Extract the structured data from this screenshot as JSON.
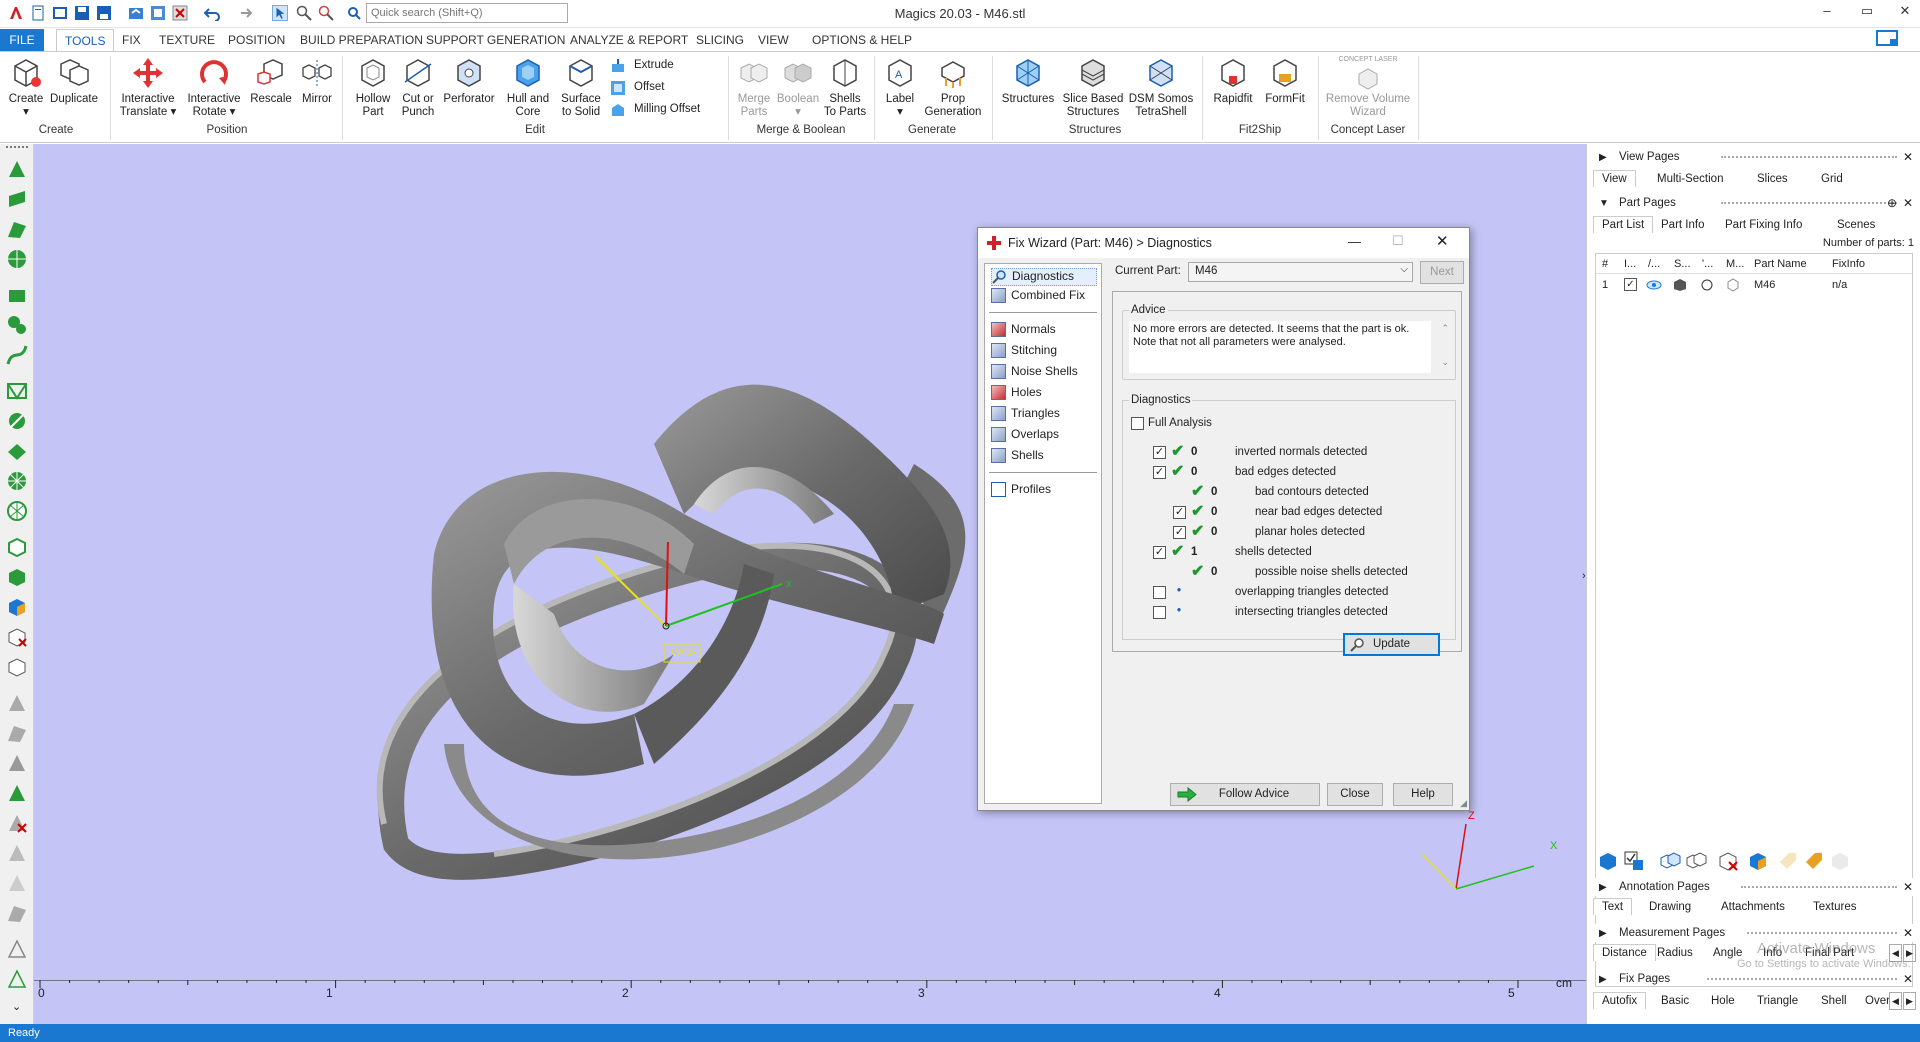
{
  "window": {
    "title": "Magics 20.03 - M46.stl",
    "minimize": "–",
    "maximize": "▭",
    "close": "✕"
  },
  "search": {
    "placeholder": "Quick search (Shift+Q)"
  },
  "menu_tabs": [
    "FILE",
    "TOOLS",
    "FIX",
    "TEXTURE",
    "POSITION",
    "BUILD PREPARATION",
    "SUPPORT GENERATION",
    "ANALYZE & REPORT",
    "SLICING",
    "VIEW",
    "OPTIONS & HELP"
  ],
  "ribbon": {
    "buttons": [
      {
        "l1": "Create",
        "l2": "▾"
      },
      {
        "l1": "Duplicate",
        "l2": ""
      },
      {
        "l1": "Interactive",
        "l2": "Translate ▾"
      },
      {
        "l1": "Interactive",
        "l2": "Rotate ▾"
      },
      {
        "l1": "Rescale",
        "l2": ""
      },
      {
        "l1": "Mirror",
        "l2": ""
      },
      {
        "l1": "Hollow",
        "l2": "Part"
      },
      {
        "l1": "Cut or",
        "l2": "Punch"
      },
      {
        "l1": "Perforator",
        "l2": ""
      },
      {
        "l1": "Hull and",
        "l2": "Core"
      },
      {
        "l1": "Surface",
        "l2": "to Solid"
      },
      {
        "l1": "Merge",
        "l2": "Parts"
      },
      {
        "l1": "Boolean",
        "l2": "▾"
      },
      {
        "l1": "Shells",
        "l2": "To Parts"
      },
      {
        "l1": "Label",
        "l2": "▾"
      },
      {
        "l1": "Prop",
        "l2": "Generation"
      },
      {
        "l1": "Structures",
        "l2": ""
      },
      {
        "l1": "Slice Based",
        "l2": "Structures"
      },
      {
        "l1": "DSM Somos",
        "l2": "TetraShell"
      },
      {
        "l1": "Rapidfit",
        "l2": ""
      },
      {
        "l1": "FormFit",
        "l2": ""
      },
      {
        "l1": "Remove Volume",
        "l2": "Wizard"
      }
    ],
    "small_buttons": [
      "Extrude",
      "Offset",
      "Milling Offset"
    ],
    "concept_laser_logo": "CONCEPT LASER",
    "groups": [
      "Create",
      "Position",
      "Edit",
      "Merge & Boolean",
      "Generate",
      "Structures",
      "Fit2Ship",
      "Concept Laser"
    ]
  },
  "viewport": {
    "wcs_label": "WCS",
    "ruler_ticks": [
      "0",
      "1",
      "2",
      "3",
      "4",
      "5"
    ],
    "ruler_unit": "cm",
    "axes": {
      "x": "x",
      "z": "z",
      "bx": "X",
      "bz": "Z"
    }
  },
  "status": "Ready",
  "right_panel": {
    "view_pages": {
      "title": "View Pages",
      "tabs": [
        "View",
        "Multi-Section",
        "Slices",
        "Grid"
      ]
    },
    "part_pages": {
      "title": "Part Pages",
      "tabs": [
        "Part List",
        "Part Info",
        "Part Fixing Info",
        "Scenes"
      ],
      "count_label": "Number of parts: 1",
      "columns": [
        "#",
        "I...",
        "/...",
        "S...",
        "'...",
        "M...",
        "Part Name",
        "FixInfo"
      ],
      "rows": [
        {
          "num": "1",
          "name": "M46",
          "fixinfo": "n/a"
        }
      ]
    },
    "annotation_pages": {
      "title": "Annotation Pages",
      "tabs": [
        "Text",
        "Drawing",
        "Attachments",
        "Textures"
      ]
    },
    "measurement_pages": {
      "title": "Measurement Pages",
      "tabs": [
        "Distance",
        "Radius",
        "Angle",
        "Info",
        "Final Part"
      ]
    },
    "fix_pages": {
      "title": "Fix Pages",
      "tabs": [
        "Autofix",
        "Basic",
        "Hole",
        "Triangle",
        "Shell",
        "Over"
      ]
    },
    "watermark": {
      "line1": "Activate Windows",
      "line2": "Go to Settings to activate Windows."
    }
  },
  "dialog": {
    "title": "Fix Wizard (Part: M46) > Diagnostics",
    "nav": [
      "Diagnostics",
      "Combined Fix",
      "Normals",
      "Stitching",
      "Noise Shells",
      "Holes",
      "Triangles",
      "Overlaps",
      "Shells",
      "Profiles"
    ],
    "current_part_label": "Current Part:",
    "current_part": "M46",
    "next": "Next",
    "advice_title": "Advice",
    "advice_text": "No more errors are detected. It seems that the part is ok.\nNote that not all parameters were analysed.",
    "diag_title": "Diagnostics",
    "full_analysis": "Full Analysis",
    "rows": [
      {
        "value": "0",
        "label": "inverted normals detected"
      },
      {
        "value": "0",
        "label": "bad edges detected"
      },
      {
        "value": "0",
        "label": "bad contours detected"
      },
      {
        "value": "0",
        "label": "near bad edges detected"
      },
      {
        "value": "0",
        "label": "planar holes detected"
      },
      {
        "value": "1",
        "label": "shells detected"
      },
      {
        "value": "0",
        "label": "possible noise shells detected"
      },
      {
        "value": "•",
        "label": "overlapping triangles detected"
      },
      {
        "value": "•",
        "label": "intersecting triangles detected"
      }
    ],
    "update": "Update",
    "follow_advice": "Follow Advice",
    "close": "Close",
    "help": "Help"
  }
}
